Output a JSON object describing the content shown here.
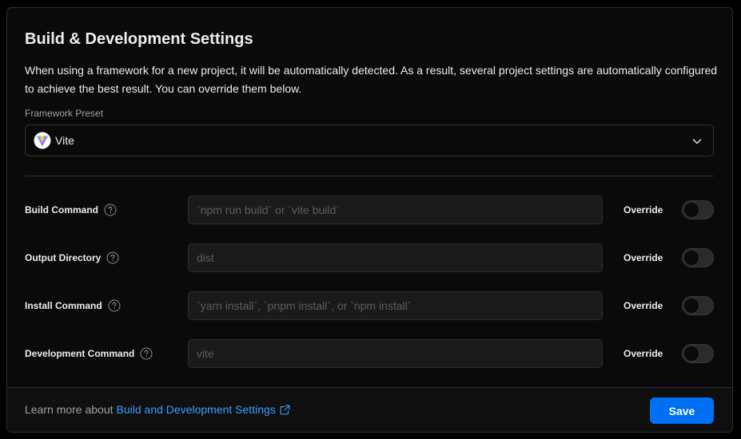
{
  "title": "Build & Development Settings",
  "description": "When using a framework for a new project, it will be automatically detected. As a result, several project settings are automatically configured to achieve the best result. You can override them below.",
  "framework_preset": {
    "label": "Framework Preset",
    "value": "Vite",
    "icon": "vite-logo-icon"
  },
  "rows": [
    {
      "label": "Build Command",
      "placeholder": "`npm run build` or `vite build`",
      "override_label": "Override",
      "override_on": false
    },
    {
      "label": "Output Directory",
      "placeholder": "dist",
      "override_label": "Override",
      "override_on": false
    },
    {
      "label": "Install Command",
      "placeholder": "`yarn install`, `pnpm install`, or `npm install`",
      "override_label": "Override",
      "override_on": false
    },
    {
      "label": "Development Command",
      "placeholder": "vite",
      "override_label": "Override",
      "override_on": false
    }
  ],
  "footer": {
    "text": "Learn more about",
    "link_text": "Build and Development Settings",
    "save_label": "Save"
  },
  "colors": {
    "background": "#000000",
    "card": "#0a0a0a",
    "accent": "#0070f3",
    "link": "#3b9eff"
  }
}
